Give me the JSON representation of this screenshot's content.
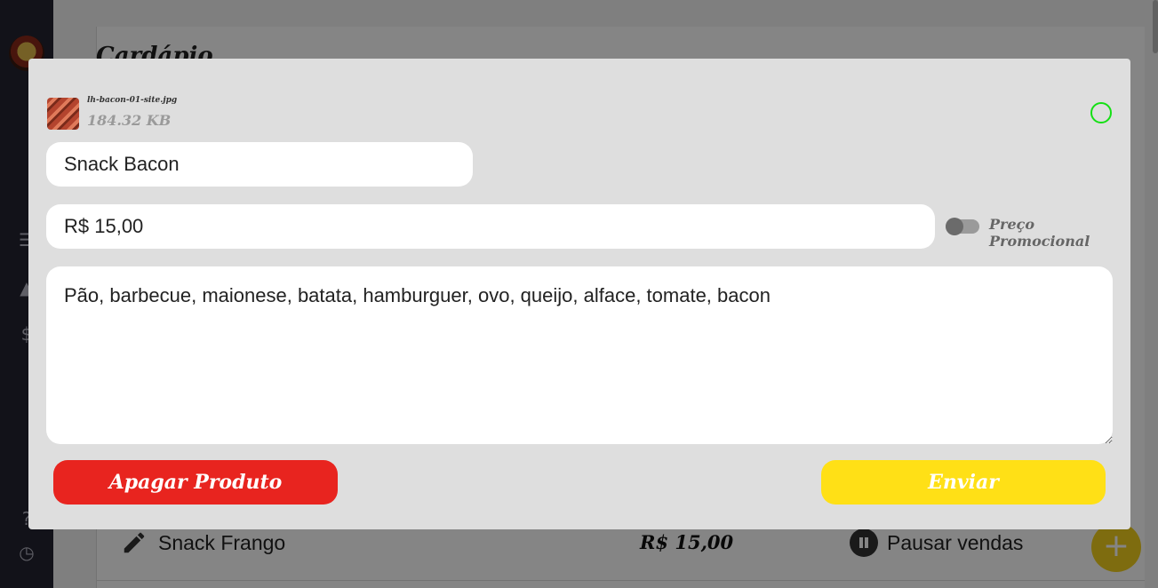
{
  "app": {
    "page_title": "Cardápio",
    "product_row": {
      "name": "Snack Frango",
      "price": "R$ 15,00",
      "pause_label": "Pausar vendas"
    },
    "fab_label": "+"
  },
  "modal": {
    "file": {
      "name": "lh-bacon-01-site.jpg",
      "size": "184.32 KB"
    },
    "name_value": "Snack Bacon",
    "price_value": "R$ 15,00",
    "promo_toggle": {
      "label": "Preço Promocional",
      "on": false
    },
    "description_value": "Pão, barbecue, maionese, batata, hamburguer, ovo, queijo, alface, tomate, bacon",
    "delete_label": "Apagar Produto",
    "send_label": "Enviar",
    "colors": {
      "delete": "#e8241f",
      "send": "#ffe016",
      "status": "#14e014"
    }
  }
}
